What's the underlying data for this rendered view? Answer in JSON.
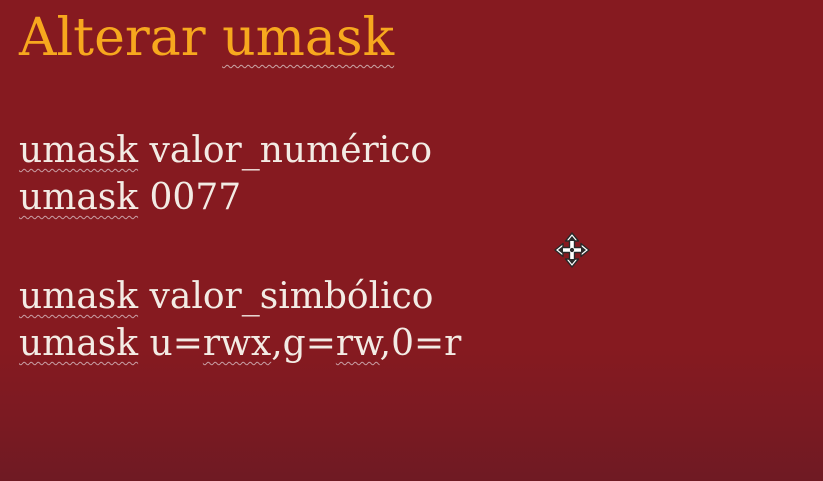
{
  "slide": {
    "title": {
      "word1": "Alterar",
      "word2": "umask"
    },
    "lines": [
      {
        "cmd": "umask",
        "arg": "valor_numérico"
      },
      {
        "cmd": "umask",
        "arg": "0077"
      },
      {
        "cmd": "umask",
        "arg": "valor_simbólico"
      },
      {
        "cmd": "umask",
        "sep1": "u=",
        "p1": "rwx",
        "sep2": ",g=",
        "p2": "rw",
        "sep3": ",0=r"
      }
    ]
  },
  "colors": {
    "background": "#861a20",
    "title": "#f7a81e",
    "body_text": "#f3ebe4",
    "spellcheck_underline": "#c9a0a5"
  },
  "cursor": {
    "icon": "move-cursor-icon"
  }
}
